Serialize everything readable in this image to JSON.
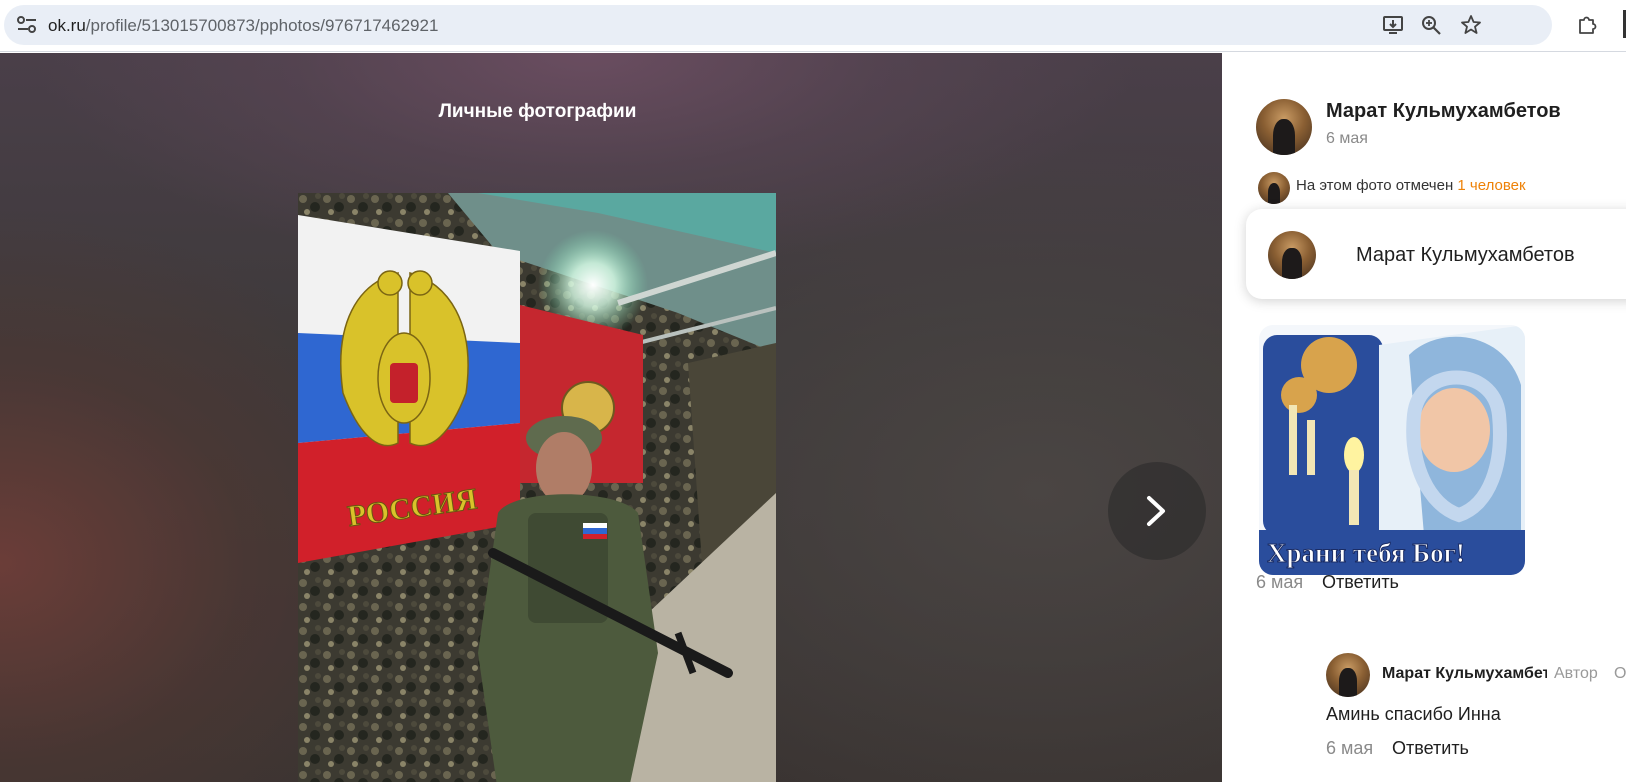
{
  "browser": {
    "url_host": "ok.ru",
    "url_path": "/profile/513015700873/pphotos/976717462921"
  },
  "viewer": {
    "album_title": "Личные фотографии"
  },
  "panel": {
    "author_name": "Марат Кульмухамбетов",
    "author_date": "6 мая",
    "tagged_prefix": "На этом фото отмечен",
    "tagged_link": "1 человек",
    "popup_name": "Марат Кульмухамбетов",
    "comment": {
      "sticker_caption": "Храни тебя Бог!",
      "date": "6 мая",
      "reply_label": "Ответить"
    },
    "reply": {
      "name": "Марат Кульмухамбетов",
      "badge": "Автор",
      "badge_cut": "О",
      "text": "Аминь спасибо Инна",
      "date": "6 мая",
      "reply_label": "Ответить"
    }
  },
  "colors": {
    "link": "#ee8208",
    "omnibox": "#e9eef6"
  }
}
